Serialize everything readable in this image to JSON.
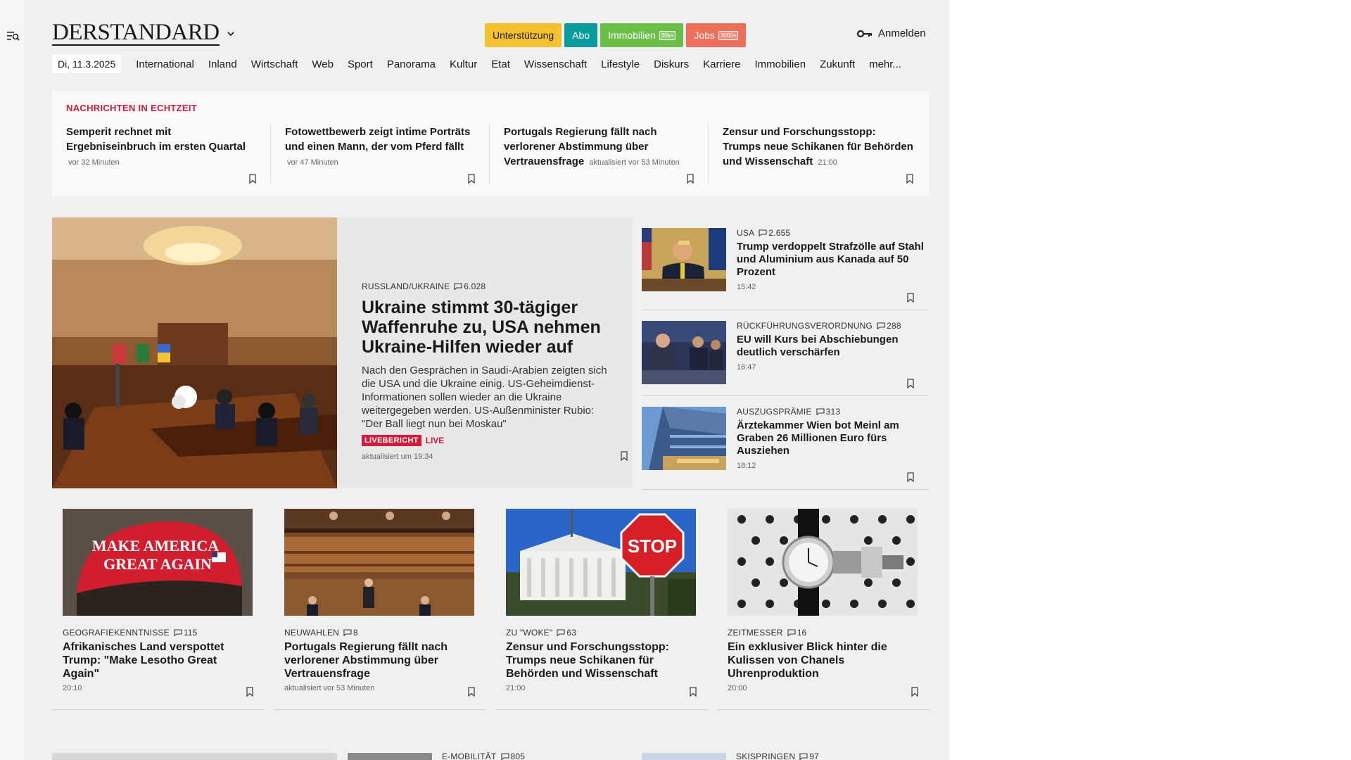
{
  "header": {
    "logo": "DERSTANDARD",
    "buttons": {
      "support": "Unterstützung",
      "abo": "Abo",
      "immobilien": "Immobilien",
      "immobilien_badge": "30k+",
      "jobs": "Jobs",
      "jobs_badge": "3000+"
    },
    "login": "Anmelden"
  },
  "nav": {
    "date": "Di, 11.3.2025",
    "items": [
      "International",
      "Inland",
      "Wirtschaft",
      "Web",
      "Sport",
      "Panorama",
      "Kultur",
      "Etat",
      "Wissenschaft",
      "Lifestyle",
      "Diskurs",
      "Karriere",
      "Immobilien",
      "Zukunft",
      "mehr..."
    ]
  },
  "ticker": {
    "title": "NACHRICHTEN IN ECHTZEIT",
    "items": [
      {
        "title": "Semperit rechnet mit Ergebniseinbruch im ersten Quartal",
        "time": "vor 32 Minuten"
      },
      {
        "title": "Fotowettbewerb zeigt intime Porträts und einen Mann, der vom Pferd fällt",
        "time": "vor 47 Minuten"
      },
      {
        "title": "Portugals Regierung fällt nach verlorener Abstimmung über Vertrauensfrage",
        "time": "aktualisiert vor 53 Minuten"
      },
      {
        "title": "Zensur und Forschungsstopp: Trumps neue Schikanen für Behörden und Wissenschaft",
        "time": "21:00"
      }
    ]
  },
  "hero": {
    "kicker": "RUSSLAND/UKRAINE",
    "comments": "6.028",
    "title": "Ukraine stimmt 30-tägiger Waffenruhe zu, USA nehmen Ukraine-Hilfen wieder auf",
    "lead": "Nach den Gesprächen in Saudi-Arabien zeigten sich die USA und die Ukraine einig. US-Geheimdienst-Informationen sollen wieder an die Ukraine weitergegeben werden. US-Außenminister Rubio: \"Der Ball liegt nun bei Moskau\"",
    "badge": "LIVEBERICHT",
    "live": "LIVE",
    "time": "aktualisiert um 19:34"
  },
  "side": [
    {
      "kicker": "USA",
      "comments": "2.655",
      "title": "Trump verdoppelt Strafzölle auf Stahl und Aluminium aus Kanada auf 50 Prozent",
      "time": "15:42"
    },
    {
      "kicker": "RÜCKFÜHRUNGSVERORDNUNG",
      "comments": "288",
      "title": "EU will Kurs bei Abschiebungen deutlich verschärfen",
      "time": "16:47"
    },
    {
      "kicker": "AUSZUGSPRÄMIE",
      "comments": "313",
      "title": "Ärztekammer Wien bot Meinl am Graben 26 Millionen Euro fürs Ausziehen",
      "time": "18:12"
    }
  ],
  "grid": [
    {
      "kicker": "GEOGRAFIEKENNTNISSE",
      "comments": "115",
      "title": "Afrikanisches Land verspottet Trump: \"Make Lesotho Great Again\"",
      "time": "20:10",
      "img_text_1": "MAKE AMERICA",
      "img_text_2": "GREAT AGAIN"
    },
    {
      "kicker": "NEUWAHLEN",
      "comments": "8",
      "title": "Portugals Regierung fällt nach verlorener Abstimmung über Vertrauensfrage",
      "time": "aktualisiert vor 53 Minuten"
    },
    {
      "kicker": "ZU \"WOKE\"",
      "comments": "63",
      "title": "Zensur und Forschungsstopp: Trumps neue Schikanen für Behörden und Wissenschaft",
      "time": "21:00",
      "img_text": "STOP"
    },
    {
      "kicker": "ZEITMESSER",
      "comments": "16",
      "title": "Ein exklusiver Blick hinter die Kulissen von Chanels Uhrenproduktion",
      "time": "20:00"
    }
  ],
  "bottom": [
    {
      "kicker": "E-MOBILITÄT",
      "comments": "805"
    },
    {
      "kicker": "SKISPRINGEN",
      "comments": "97"
    }
  ],
  "colors": {
    "accent_red": "#d4193b",
    "support": "#f5c12e",
    "abo": "#0a9c9c",
    "immobilien": "#6cc04a",
    "jobs": "#ee6e5c"
  }
}
